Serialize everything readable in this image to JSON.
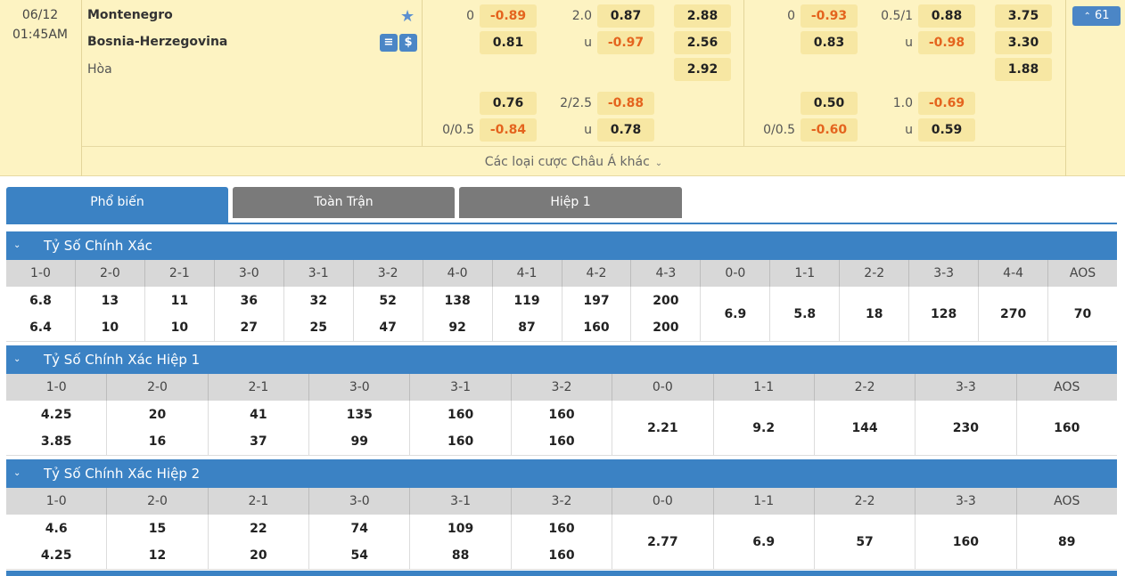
{
  "match": {
    "date": "06/12",
    "time": "01:45AM",
    "home": "Montenegro",
    "away": "Bosnia-Herzegovina",
    "draw_label": "Hòa",
    "favorite_icon": "star-icon",
    "count_label": "61",
    "more_label": "Các loại cược Châu Á khác",
    "colors": {
      "accent": "#3b82c4",
      "header_bg": "#fdf3c2",
      "negative": "#e4641e"
    }
  },
  "ft": {
    "row1": {
      "hdp": "0",
      "home": "-0.89",
      "ou_line": "2.0",
      "over": "0.87",
      "x1": "2.88"
    },
    "row2": {
      "home": "0.81",
      "ou_label": "u",
      "under": "-0.97",
      "x2": "2.56"
    },
    "row3": {
      "xd": "2.92"
    },
    "row4": {
      "home": "0.76",
      "ou_line": "2/2.5",
      "over": "-0.88"
    },
    "row5": {
      "hdp": "0/0.5",
      "away": "-0.84",
      "ou_label": "u",
      "under": "0.78"
    }
  },
  "h1": {
    "row1": {
      "hdp": "0",
      "home": "-0.93",
      "ou_line": "0.5/1",
      "over": "0.88",
      "x1": "3.75"
    },
    "row2": {
      "home": "0.83",
      "ou_label": "u",
      "under": "-0.98",
      "x2": "3.30"
    },
    "row3": {
      "xd": "1.88"
    },
    "row4": {
      "home": "0.50",
      "ou_line": "1.0",
      "over": "-0.69"
    },
    "row5": {
      "hdp": "0/0.5",
      "away": "-0.60",
      "ou_label": "u",
      "under": "0.59"
    }
  },
  "tabs": [
    {
      "label": "Phổ biến"
    },
    {
      "label": "Toàn Trận"
    },
    {
      "label": "Hiệp 1"
    }
  ],
  "sections": [
    {
      "title": "Tỷ Số Chính Xác",
      "headers": [
        "1-0",
        "2-0",
        "2-1",
        "3-0",
        "3-1",
        "3-2",
        "4-0",
        "4-1",
        "4-2",
        "4-3",
        "0-0",
        "1-1",
        "2-2",
        "3-3",
        "4-4",
        "AOS"
      ],
      "top": [
        "6.8",
        "13",
        "11",
        "36",
        "32",
        "52",
        "138",
        "119",
        "197",
        "200",
        "",
        "",
        "",
        "",
        "",
        ""
      ],
      "bottom": [
        "6.4",
        "10",
        "10",
        "27",
        "25",
        "47",
        "92",
        "87",
        "160",
        "200",
        "",
        "",
        "",
        "",
        "",
        ""
      ],
      "single": [
        "",
        "",
        "",
        "",
        "",
        "",
        "",
        "",
        "",
        "",
        "6.9",
        "5.8",
        "18",
        "128",
        "270",
        "70"
      ]
    },
    {
      "title": "Tỷ Số Chính Xác Hiệp 1",
      "headers": [
        "1-0",
        "2-0",
        "2-1",
        "3-0",
        "3-1",
        "3-2",
        "0-0",
        "1-1",
        "2-2",
        "3-3",
        "AOS"
      ],
      "top": [
        "4.25",
        "20",
        "41",
        "135",
        "160",
        "160",
        "",
        "",
        "",
        "",
        ""
      ],
      "bottom": [
        "3.85",
        "16",
        "37",
        "99",
        "160",
        "160",
        "",
        "",
        "",
        "",
        ""
      ],
      "single": [
        "",
        "",
        "",
        "",
        "",
        "",
        "2.21",
        "9.2",
        "144",
        "230",
        "160"
      ]
    },
    {
      "title": "Tỷ Số Chính Xác Hiệp 2",
      "headers": [
        "1-0",
        "2-0",
        "2-1",
        "3-0",
        "3-1",
        "3-2",
        "0-0",
        "1-1",
        "2-2",
        "3-3",
        "AOS"
      ],
      "top": [
        "4.6",
        "15",
        "22",
        "74",
        "109",
        "160",
        "",
        "",
        "",
        "",
        ""
      ],
      "bottom": [
        "4.25",
        "12",
        "20",
        "54",
        "88",
        "160",
        "",
        "",
        "",
        "",
        ""
      ],
      "single": [
        "",
        "",
        "",
        "",
        "",
        "",
        "2.77",
        "6.9",
        "57",
        "160",
        "89"
      ]
    }
  ]
}
